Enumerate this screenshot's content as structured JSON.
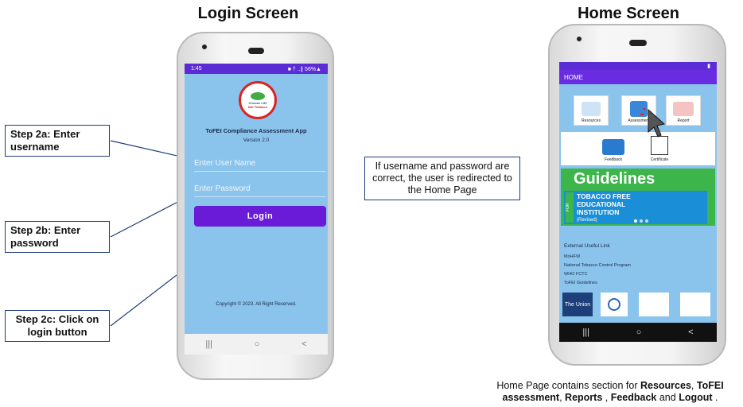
{
  "titles": {
    "login": "Login Screen",
    "home": "Home Screen"
  },
  "callouts": {
    "step2a": "Step 2a: Enter username",
    "step2b": "Step 2b: Enter password",
    "step2c": "Step 2c: Click on login button"
  },
  "redirect_note": "If username and password are correct, the user is redirected to the Home Page",
  "login_app": {
    "status_time": "1:45",
    "status_icons": "■ † ..∥ 56%▲",
    "logo_text_line1": "Choose Life",
    "logo_text_line2": "Not Tobacco",
    "app_title": "ToFEI Compliance Assessment App",
    "version": "Version 2.0",
    "username_placeholder": "Enter User Name",
    "password_placeholder": "Enter Password",
    "login_label": "Login",
    "copyright": "Copyright © 2023. All Right Reserved."
  },
  "home_app": {
    "header": "HOME",
    "tiles": [
      {
        "label": "Resources"
      },
      {
        "label": "Assessment"
      },
      {
        "label": "Report"
      },
      {
        "label": "Feedback"
      },
      {
        "label": "Certificate"
      }
    ],
    "banner": {
      "title": "Guidelines",
      "for_tag": "FOR",
      "line1": "TOBACCO FREE",
      "line2": "EDUCATIONAL",
      "line3": "INSTITUTION",
      "line4": "(Revised)"
    },
    "external_links_title": "External Useful Link",
    "external_links": [
      "MoHFW",
      "National Tobacco Control Program",
      "WHO FCTC",
      "ToFEI Guidelines"
    ],
    "partners": [
      "The Union"
    ]
  },
  "nav_icons": [
    "recent-apps-icon",
    "home-circle-icon",
    "back-chevron-icon"
  ],
  "bottom_caption": {
    "prefix": "Home Page contains section for ",
    "resources": "Resources",
    "sep1": ", ",
    "tofei": "ToFEI assessment",
    "sep2": ", ",
    "reports": "Reports",
    "sep3": " , ",
    "feedback": "Feedback",
    "sep4": " and ",
    "logout": "Logout",
    "suffix": " ."
  },
  "colors": {
    "screen_bg": "#8ac4ec",
    "statusbar": "#5b2bd6",
    "login_button": "#6a1bd8",
    "banner_green": "#3cb54a",
    "callout_border": "#1f3b7a"
  }
}
